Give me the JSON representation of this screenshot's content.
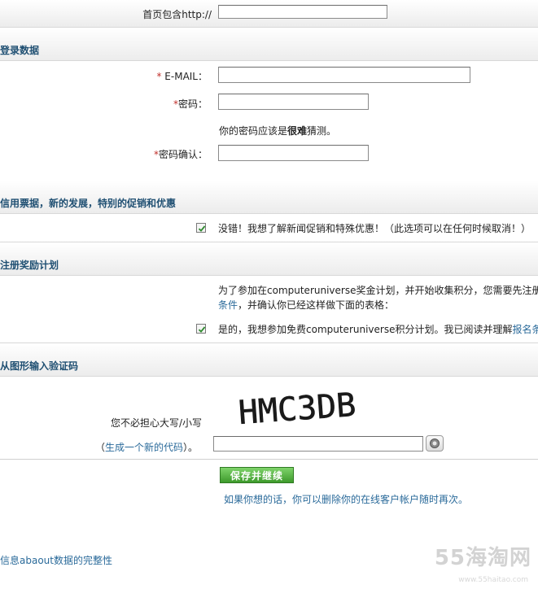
{
  "homepage": {
    "label": "首页包含http://",
    "value": ""
  },
  "login": {
    "title": "登录数据",
    "email_label": "E-MAIL：",
    "email_required": "*",
    "email_value": "",
    "password_label": "密码：",
    "password_required": "*",
    "password_value": "",
    "hint_prefix": "你的密码应该是",
    "hint_bold": "很难",
    "hint_suffix": "猜测。",
    "confirm_label": "密码确认：",
    "confirm_required": "*",
    "confirm_value": ""
  },
  "newsletter": {
    "title": "信用票据，新的发展，特别的促销和优惠",
    "checkbox_label": "没错！我想了解新闻促销和特殊优惠！（此选项可以在任何时候取消！）",
    "checked": true
  },
  "rewards": {
    "title": "注册奖励计划",
    "desc_line1": "为了参加在computeruniverse奖金计划，并开始收集积分，您需要先注册。",
    "desc_line2_link": "条件",
    "desc_line2_rest": "，并确认你已经这样做下面的表格：",
    "checkbox_label": "是的，我想参加免费computeruniverse积分计划。我已阅读并理解",
    "checkbox_link": "报名条件",
    "checked": true
  },
  "captcha": {
    "title": "从图形输入验证码",
    "image_text": "HMC3DB",
    "case_hint": "您不必担心大写/小写",
    "regen_open": "（",
    "regen_link": "生成一个新的代码",
    "regen_close": "）。",
    "value": ""
  },
  "actions": {
    "save_label": "保存并继续",
    "delete_note": "如果你想的话，你可以删除你的在线客户帐户随时再次。"
  },
  "footer": {
    "integrity_link": "信息abaout数据的完整性"
  },
  "watermark": {
    "text": "55海淘网",
    "sub": "www.55haitao.com"
  },
  "colors": {
    "accent": "#1f4f72",
    "link": "#2a6a9a",
    "button": "#4aa838",
    "required": "#c0302b"
  }
}
